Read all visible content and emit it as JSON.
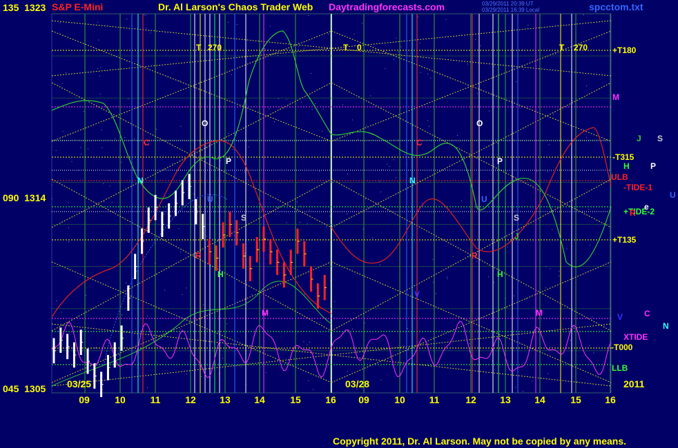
{
  "header": {
    "instrument": "S&P E-Mini",
    "site_title": "Dr. Al Larson's Chaos Trader Web",
    "site_url": "Daytradingforecasts.com",
    "timestamp_1": "03/29/2011 20:39 UT",
    "timestamp_2": "03/29/2011 16:39 Local",
    "filename": "spcctom.txt"
  },
  "y_axis_labels": [
    {
      "left": "135",
      "right": "1323"
    },
    {
      "left": "090",
      "right": "1314"
    },
    {
      "left": "045",
      "right": "1305"
    }
  ],
  "session_labels": [
    "03/25",
    "03/28"
  ],
  "year_label": "2011",
  "copyright": "Copyright 2011, Dr. Al Larson. May not be copied by any means.",
  "line_labels": [
    {
      "text": "+T180",
      "color": "#ffff00"
    },
    {
      "text": "M",
      "color": "#ff33ff"
    },
    {
      "text": "-T315",
      "color": "#ffff00"
    },
    {
      "text": "ULB",
      "color": "#ff2222"
    },
    {
      "text": "-TIDE-1",
      "color": "#ff2222"
    },
    {
      "text": "+TIDE-2",
      "color": "#33ff33"
    },
    {
      "text": "+T135",
      "color": "#ffff00"
    },
    {
      "text": "XTIDE",
      "color": "#ff33ff"
    },
    {
      "text": "-T000",
      "color": "#ffff00"
    },
    {
      "text": "LLB",
      "color": "#33ff33"
    }
  ],
  "legend_letters": [
    {
      "text": "J",
      "color": "#33cc33"
    },
    {
      "text": "S",
      "color": "#cccccc"
    },
    {
      "text": "H",
      "color": "#33ff33"
    },
    {
      "text": "P",
      "color": "#ffffff"
    },
    {
      "text": "U",
      "color": "#3366ff"
    },
    {
      "text": "R",
      "color": "#ff2222"
    },
    {
      "text": "e",
      "color": "#ffffff"
    },
    {
      "text": "V",
      "color": "#3333ff"
    },
    {
      "text": "C",
      "color": "#ff33ff"
    },
    {
      "text": "N",
      "color": "#33ffff"
    }
  ],
  "chart_marker_letters": [
    {
      "text": "T",
      "color": "#ffff00"
    },
    {
      "text": "270",
      "color": "#ffff00"
    },
    {
      "text": "T",
      "color": "#ffff00"
    },
    {
      "text": "0",
      "color": "#ffff00"
    },
    {
      "text": "T",
      "color": "#ffff00"
    },
    {
      "text": "270",
      "color": "#ffff00"
    },
    {
      "text": "O",
      "color": "#ffffff"
    },
    {
      "text": "O",
      "color": "#ffffff"
    },
    {
      "text": "C",
      "color": "#ff3333"
    },
    {
      "text": "C",
      "color": "#ff3333"
    },
    {
      "text": "P",
      "color": "#ffffff"
    },
    {
      "text": "P",
      "color": "#ffffff"
    },
    {
      "text": "N",
      "color": "#33ffff"
    },
    {
      "text": "N",
      "color": "#33ffff"
    },
    {
      "text": "S",
      "color": "#cccccc"
    },
    {
      "text": "S",
      "color": "#cccccc"
    },
    {
      "text": "H",
      "color": "#33ff33"
    },
    {
      "text": "H",
      "color": "#33ff33"
    },
    {
      "text": "M",
      "color": "#ff33ff"
    },
    {
      "text": "M",
      "color": "#ff33ff"
    },
    {
      "text": "U",
      "color": "#3366ff"
    },
    {
      "text": "U",
      "color": "#3366ff"
    },
    {
      "text": "R",
      "color": "#ff3333"
    },
    {
      "text": "R",
      "color": "#ff3333"
    },
    {
      "text": "V",
      "color": "#3333ff"
    },
    {
      "text": "J",
      "color": "#33cc33"
    }
  ],
  "chart_data": {
    "type": "line",
    "title": "S&P E-Mini",
    "x_tick_labels": [
      "09",
      "10",
      "11",
      "12",
      "13",
      "14",
      "15",
      "16",
      "09",
      "10",
      "11",
      "12",
      "13",
      "14",
      "15",
      "16"
    ],
    "y_ticks": [
      1305,
      1314,
      1323
    ],
    "ylim": [
      1305,
      1323
    ],
    "grid": true,
    "series": [
      {
        "name": "S&P E-Mini",
        "type": "ohlc",
        "values_day1": [
          1307.0,
          1307.5,
          1307.2,
          1306.8,
          1307.4,
          1306.5,
          1305.8,
          1305.4,
          1306.2,
          1306.8,
          1307.6,
          1309.5,
          1311.0,
          1312.2,
          1313.2,
          1313.8,
          1313.0,
          1313.4,
          1314.0,
          1314.5,
          1314.8,
          1313.6,
          1312.9,
          1311.7,
          1311.4,
          1312.5,
          1313.0,
          1312.6,
          1311.5,
          1310.9,
          1311.8,
          1312.3,
          1311.7,
          1311.2,
          1310.6,
          1311.2,
          1312.2,
          1311.6,
          1310.4,
          1309.6,
          1310.0
        ]
      },
      {
        "name": "ULB",
        "color": "#dd2222"
      },
      {
        "name": "TIDE-2",
        "color": "#33cc33"
      },
      {
        "name": "XTIDE",
        "color": "#ff33ff"
      }
    ]
  }
}
